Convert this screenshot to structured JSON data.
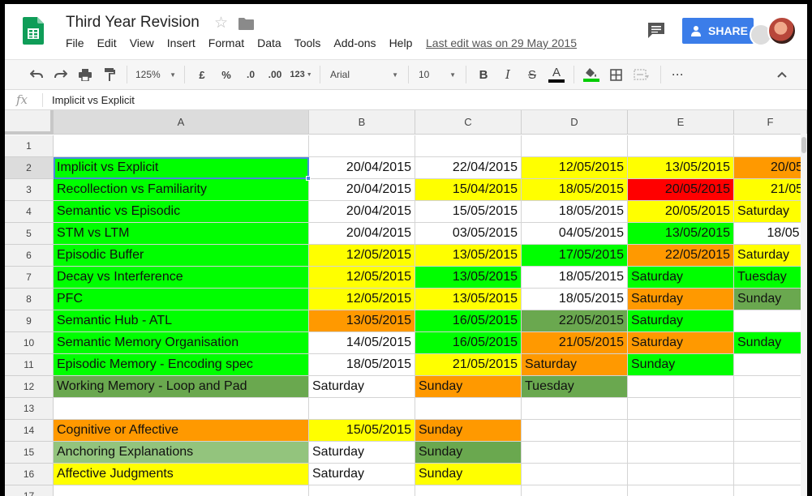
{
  "title": "Third Year Revision",
  "menu": [
    "File",
    "Edit",
    "View",
    "Insert",
    "Format",
    "Data",
    "Tools",
    "Add-ons",
    "Help"
  ],
  "last_edit": "Last edit was on 29 May 2015",
  "share_label": "SHARE",
  "toolbar": {
    "zoom": "125%",
    "currency": "£",
    "percent": "%",
    "dec_decrease": ".0",
    "dec_increase": ".00",
    "more_formats": "123",
    "font": "Arial",
    "font_size": "10",
    "bold": "B",
    "italic": "I",
    "strike": "S",
    "text_color": "A",
    "more": "···",
    "fill_underline_color": "#00cc00",
    "text_underline_color": "#000000"
  },
  "formula_bar": {
    "fx": "fx",
    "value": "Implicit vs Explicit"
  },
  "columns": [
    "A",
    "B",
    "C",
    "D",
    "E",
    "F"
  ],
  "colors": {
    "G": "#00ff00",
    "Y": "#ffff00",
    "O": "#ff9900",
    "R": "#ff0000",
    "D": "#6aa84f",
    "L": "#93c47d",
    "W": "#ffffff"
  },
  "rows": [
    {
      "num": "1",
      "cells": [
        {
          "t": "",
          "c": "W"
        },
        {
          "t": "",
          "c": "W"
        },
        {
          "t": "",
          "c": "W"
        },
        {
          "t": "",
          "c": "W"
        },
        {
          "t": "",
          "c": "W"
        },
        {
          "t": "",
          "c": "W"
        }
      ]
    },
    {
      "num": "2",
      "cells": [
        {
          "t": "Implicit vs Explicit",
          "c": "G"
        },
        {
          "t": "20/04/2015",
          "c": "W",
          "r": true
        },
        {
          "t": "22/04/2015",
          "c": "W",
          "r": true
        },
        {
          "t": "12/05/2015",
          "c": "Y",
          "r": true
        },
        {
          "t": "13/05/2015",
          "c": "Y",
          "r": true
        },
        {
          "t": "20/05",
          "c": "O",
          "r": true
        }
      ]
    },
    {
      "num": "3",
      "cells": [
        {
          "t": "Recollection vs Familiarity",
          "c": "G"
        },
        {
          "t": "20/04/2015",
          "c": "W",
          "r": true
        },
        {
          "t": "15/04/2015",
          "c": "Y",
          "r": true
        },
        {
          "t": "18/05/2015",
          "c": "Y",
          "r": true
        },
        {
          "t": "20/05/2015",
          "c": "R",
          "r": true
        },
        {
          "t": "21/05",
          "c": "Y",
          "r": true
        }
      ]
    },
    {
      "num": "4",
      "cells": [
        {
          "t": "Semantic vs Episodic",
          "c": "G"
        },
        {
          "t": "20/04/2015",
          "c": "W",
          "r": true
        },
        {
          "t": "15/05/2015",
          "c": "W",
          "r": true
        },
        {
          "t": "18/05/2015",
          "c": "W",
          "r": true
        },
        {
          "t": "20/05/2015",
          "c": "Y",
          "r": true
        },
        {
          "t": "Saturday",
          "c": "Y"
        }
      ]
    },
    {
      "num": "5",
      "cells": [
        {
          "t": "STM vs LTM",
          "c": "G"
        },
        {
          "t": "20/04/2015",
          "c": "W",
          "r": true
        },
        {
          "t": "03/05/2015",
          "c": "W",
          "r": true
        },
        {
          "t": "04/05/2015",
          "c": "W",
          "r": true
        },
        {
          "t": "13/05/2015",
          "c": "G",
          "r": true
        },
        {
          "t": "18/05.",
          "c": "W",
          "r": true
        }
      ]
    },
    {
      "num": "6",
      "cells": [
        {
          "t": "Episodic Buffer",
          "c": "G"
        },
        {
          "t": "12/05/2015",
          "c": "Y",
          "r": true
        },
        {
          "t": "13/05/2015",
          "c": "Y",
          "r": true
        },
        {
          "t": "17/05/2015",
          "c": "G",
          "r": true
        },
        {
          "t": "22/05/2015",
          "c": "O",
          "r": true
        },
        {
          "t": "Saturday",
          "c": "Y"
        }
      ]
    },
    {
      "num": "7",
      "cells": [
        {
          "t": "Decay vs Interference",
          "c": "G"
        },
        {
          "t": "12/05/2015",
          "c": "Y",
          "r": true
        },
        {
          "t": "13/05/2015",
          "c": "G",
          "r": true
        },
        {
          "t": "18/05/2015",
          "c": "W",
          "r": true
        },
        {
          "t": "Saturday",
          "c": "G"
        },
        {
          "t": "Tuesday",
          "c": "G"
        }
      ]
    },
    {
      "num": "8",
      "cells": [
        {
          "t": "PFC",
          "c": "G"
        },
        {
          "t": "12/05/2015",
          "c": "Y",
          "r": true
        },
        {
          "t": "13/05/2015",
          "c": "Y",
          "r": true
        },
        {
          "t": "18/05/2015",
          "c": "W",
          "r": true
        },
        {
          "t": "Saturday",
          "c": "O"
        },
        {
          "t": "Sunday",
          "c": "D"
        }
      ]
    },
    {
      "num": "9",
      "cells": [
        {
          "t": "Semantic Hub - ATL",
          "c": "G"
        },
        {
          "t": "13/05/2015",
          "c": "O",
          "r": true
        },
        {
          "t": "16/05/2015",
          "c": "G",
          "r": true
        },
        {
          "t": "22/05/2015",
          "c": "D",
          "r": true
        },
        {
          "t": "Saturday",
          "c": "G"
        },
        {
          "t": "",
          "c": "W"
        }
      ]
    },
    {
      "num": "10",
      "cells": [
        {
          "t": "Semantic Memory Organisation",
          "c": "G"
        },
        {
          "t": "14/05/2015",
          "c": "W",
          "r": true
        },
        {
          "t": "16/05/2015",
          "c": "G",
          "r": true
        },
        {
          "t": "21/05/2015",
          "c": "O",
          "r": true
        },
        {
          "t": "Saturday",
          "c": "O"
        },
        {
          "t": "Sunday",
          "c": "G"
        }
      ]
    },
    {
      "num": "11",
      "cells": [
        {
          "t": "Episodic Memory - Encoding spec",
          "c": "G"
        },
        {
          "t": "18/05/2015",
          "c": "W",
          "r": true
        },
        {
          "t": "21/05/2015",
          "c": "Y",
          "r": true
        },
        {
          "t": "Saturday",
          "c": "O"
        },
        {
          "t": "Sunday",
          "c": "G"
        },
        {
          "t": "",
          "c": "W"
        }
      ]
    },
    {
      "num": "12",
      "cells": [
        {
          "t": "Working Memory - Loop and Pad",
          "c": "D"
        },
        {
          "t": "Saturday",
          "c": "W"
        },
        {
          "t": "Sunday",
          "c": "O"
        },
        {
          "t": "Tuesday",
          "c": "D"
        },
        {
          "t": "",
          "c": "W"
        },
        {
          "t": "",
          "c": "W"
        }
      ]
    },
    {
      "num": "13",
      "cells": [
        {
          "t": "",
          "c": "W"
        },
        {
          "t": "",
          "c": "W"
        },
        {
          "t": "",
          "c": "W"
        },
        {
          "t": "",
          "c": "W"
        },
        {
          "t": "",
          "c": "W"
        },
        {
          "t": "",
          "c": "W"
        }
      ]
    },
    {
      "num": "14",
      "cells": [
        {
          "t": "Cognitive or Affective",
          "c": "O"
        },
        {
          "t": "15/05/2015",
          "c": "Y",
          "r": true
        },
        {
          "t": "Sunday",
          "c": "O"
        },
        {
          "t": "",
          "c": "W"
        },
        {
          "t": "",
          "c": "W"
        },
        {
          "t": "",
          "c": "W"
        }
      ]
    },
    {
      "num": "15",
      "cells": [
        {
          "t": "Anchoring Explanations",
          "c": "L"
        },
        {
          "t": "Saturday",
          "c": "W"
        },
        {
          "t": "Sunday",
          "c": "D"
        },
        {
          "t": "",
          "c": "W"
        },
        {
          "t": "",
          "c": "W"
        },
        {
          "t": "",
          "c": "W"
        }
      ]
    },
    {
      "num": "16",
      "cells": [
        {
          "t": "Affective Judgments",
          "c": "Y"
        },
        {
          "t": "Saturday",
          "c": "W"
        },
        {
          "t": "Sunday",
          "c": "Y"
        },
        {
          "t": "",
          "c": "W"
        },
        {
          "t": "",
          "c": "W"
        },
        {
          "t": "",
          "c": "W"
        }
      ]
    },
    {
      "num": "17",
      "cells": [
        {
          "t": "",
          "c": "W"
        },
        {
          "t": "",
          "c": "W"
        },
        {
          "t": "",
          "c": "W"
        },
        {
          "t": "",
          "c": "W"
        },
        {
          "t": "",
          "c": "W"
        },
        {
          "t": "",
          "c": "W"
        }
      ]
    }
  ]
}
